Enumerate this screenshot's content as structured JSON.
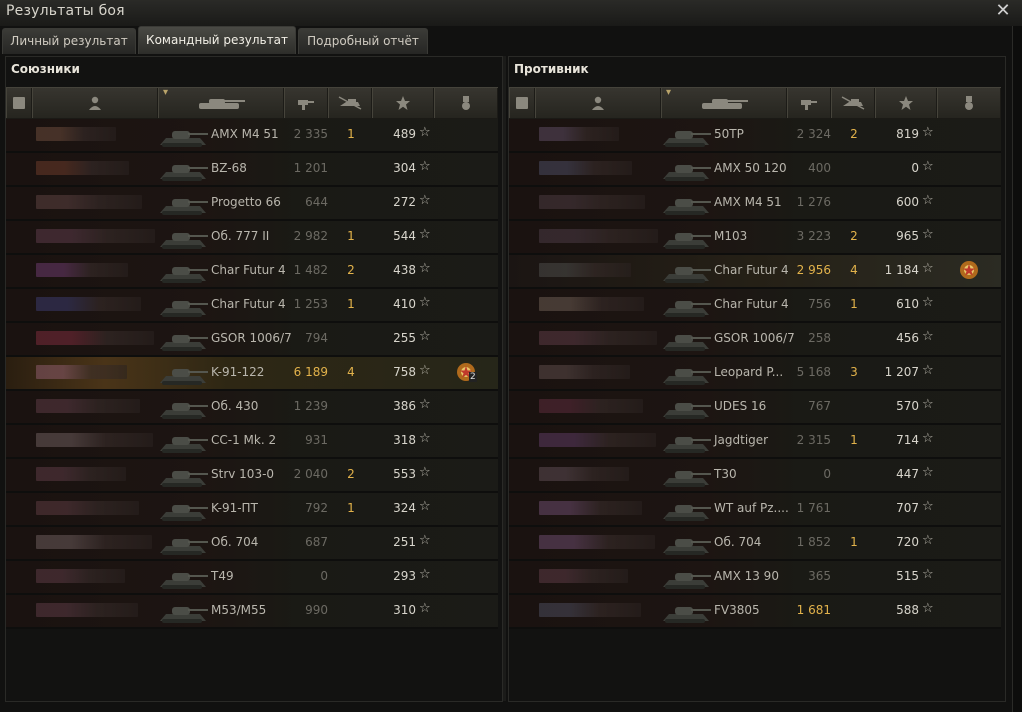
{
  "window": {
    "title": "Результаты боя",
    "close_icon": "close-icon"
  },
  "tabs": [
    {
      "label": "Личный результат",
      "active": false
    },
    {
      "label": "Командный результат",
      "active": true
    },
    {
      "label": "Подробный отчёт",
      "active": false
    }
  ],
  "allies": {
    "title": "Союзники",
    "rows": [
      {
        "tank": "AMX M4 51",
        "damage": "2 335",
        "kills": "1",
        "xp": "489",
        "hl": "normal",
        "color": "#6a4a3a"
      },
      {
        "tank": "BZ-68",
        "damage": "1 201",
        "kills": "",
        "xp": "304",
        "hl": "normal",
        "color": "#6a3a2a"
      },
      {
        "tank": "Progetto 66",
        "damage": "644",
        "kills": "",
        "xp": "272",
        "hl": "normal",
        "color": "#5a4040"
      },
      {
        "tank": "Об. 777 II",
        "damage": "2 982",
        "kills": "1",
        "xp": "544",
        "hl": "normal",
        "color": "#5a3a48"
      },
      {
        "tank": "Char Futur 4",
        "damage": "1 482",
        "kills": "2",
        "xp": "438",
        "hl": "normal",
        "color": "#6a3a6a"
      },
      {
        "tank": "Char Futur 4",
        "damage": "1 253",
        "kills": "1",
        "xp": "410",
        "hl": "normal",
        "color": "#3a3a6a"
      },
      {
        "tank": "GSOR 1006/7",
        "damage": "794",
        "kills": "",
        "xp": "255",
        "hl": "normal",
        "color": "#7a2a3a"
      },
      {
        "tank": "K-91-122",
        "damage": "6 189",
        "kills": "4",
        "xp": "758",
        "hl": "me",
        "color": "#8a5a6a",
        "medal": "2"
      },
      {
        "tank": "Об. 430",
        "damage": "1 239",
        "kills": "",
        "xp": "386",
        "hl": "normal",
        "color": "#5a3a44"
      },
      {
        "tank": "CC-1 Mk. 2",
        "damage": "931",
        "kills": "",
        "xp": "318",
        "hl": "normal",
        "color": "#6a5a5a"
      },
      {
        "tank": "Strv 103-0",
        "damage": "2 040",
        "kills": "2",
        "xp": "553",
        "hl": "normal",
        "color": "#5a3a44"
      },
      {
        "tank": "K-91-ПТ",
        "damage": "792",
        "kills": "1",
        "xp": "324",
        "hl": "normal",
        "color": "#5a3a40"
      },
      {
        "tank": "Об. 704",
        "damage": "687",
        "kills": "",
        "xp": "251",
        "hl": "normal",
        "color": "#6a5a5a"
      },
      {
        "tank": "T49",
        "damage": "0",
        "kills": "",
        "xp": "293",
        "hl": "normal",
        "color": "#5a3a44"
      },
      {
        "tank": "M53/M55",
        "damage": "990",
        "kills": "",
        "xp": "310",
        "hl": "normal",
        "color": "#5a3a44"
      }
    ]
  },
  "enemies": {
    "title": "Противник",
    "rows": [
      {
        "tank": "50TP",
        "damage": "2 324",
        "kills": "2",
        "xp": "819",
        "hl": "normal",
        "color": "#5a4a60"
      },
      {
        "tank": "AMX 50 120",
        "damage": "400",
        "kills": "",
        "xp": "0",
        "hl": "normal",
        "color": "#4a4a60"
      },
      {
        "tank": "AMX M4 51",
        "damage": "1 276",
        "kills": "",
        "xp": "600",
        "hl": "normal",
        "color": "#4a3a40"
      },
      {
        "tank": "M103",
        "damage": "3 223",
        "kills": "2",
        "xp": "965",
        "hl": "normal",
        "color": "#4a3a44"
      },
      {
        "tank": "Char Futur 4",
        "damage": "2 956",
        "kills": "4",
        "xp": "1 184",
        "hl": "top",
        "color": "#4a4a48",
        "medal": ""
      },
      {
        "tank": "Char Futur 4",
        "damage": "756",
        "kills": "1",
        "xp": "610",
        "hl": "normal",
        "color": "#6a5a50"
      },
      {
        "tank": "GSOR 1006/7",
        "damage": "258",
        "kills": "",
        "xp": "456",
        "hl": "normal",
        "color": "#5a3a44"
      },
      {
        "tank": "Leopard P...",
        "damage": "5 168",
        "kills": "3",
        "xp": "1 207",
        "hl": "normal",
        "color": "#5a4a48"
      },
      {
        "tank": "UDES 16",
        "damage": "767",
        "kills": "",
        "xp": "570",
        "hl": "normal",
        "color": "#5a2a3a"
      },
      {
        "tank": "Jagdtiger",
        "damage": "2 315",
        "kills": "1",
        "xp": "714",
        "hl": "normal",
        "color": "#5a3a60"
      },
      {
        "tank": "T30",
        "damage": "0",
        "kills": "",
        "xp": "447",
        "hl": "normal",
        "color": "#5a4a50"
      },
      {
        "tank": "WT auf Pz....",
        "damage": "1 761",
        "kills": "",
        "xp": "707",
        "hl": "normal",
        "color": "#6a4a6a"
      },
      {
        "tank": "Об. 704",
        "damage": "1 852",
        "kills": "1",
        "xp": "720",
        "hl": "normal",
        "color": "#6a4a6a"
      },
      {
        "tank": "AMX 13 90",
        "damage": "365",
        "kills": "",
        "xp": "515",
        "hl": "normal",
        "color": "#5a3a44"
      },
      {
        "tank": "FV3805",
        "damage": "1 681",
        "kills": "",
        "xp": "588",
        "hl": "normal",
        "color": "#4a4a5a",
        "dmg_gold": true
      }
    ]
  },
  "columns": [
    "platoon-icon",
    "player-icon",
    "tank-icon",
    "damage-icon",
    "kills-icon",
    "xp-star-icon",
    "medal-icon"
  ],
  "colors": {
    "accent_gold": "#e2b24b",
    "text": "#b9b6ad"
  }
}
